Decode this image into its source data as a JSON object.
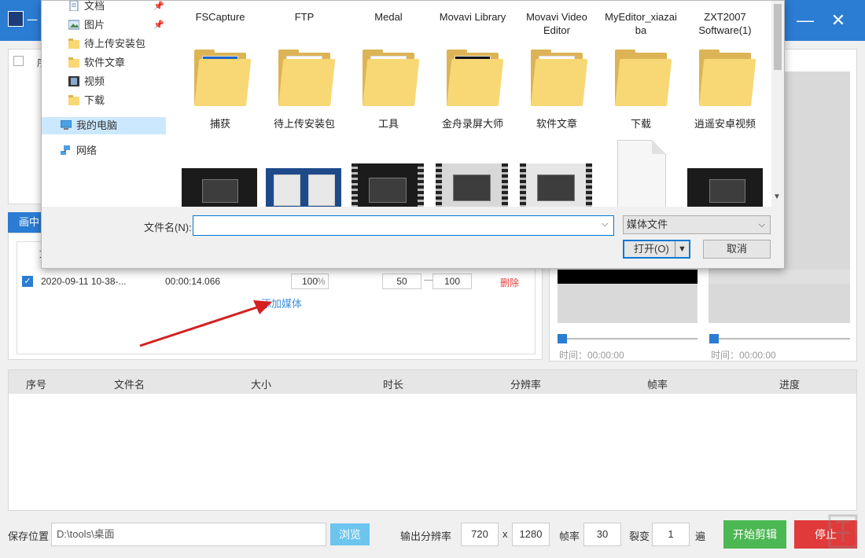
{
  "app": {
    "title": "一",
    "minimize_label": "—",
    "close_label": "✕",
    "top_panel_header_fragment": "序",
    "clip_tab_label": "画中",
    "clip_header_fragment": "文",
    "clip_row": {
      "name": "2020-09-11 10-38-...",
      "duration": "00:00:14.066",
      "percent_value": "100",
      "percent_unit": "%",
      "start_value": "50",
      "separator": "—",
      "end_value": "100",
      "delete_label": "删除"
    },
    "add_media_label": "添加媒体",
    "preview": {
      "time_left": "时间：00:00:00",
      "time_right": "时间：00:00:00"
    },
    "table": {
      "columns": [
        "序号",
        "文件名",
        "大小",
        "时长",
        "分辨率",
        "帧率",
        "进度"
      ]
    },
    "bottom": {
      "save_label": "保存位置",
      "save_path": "D:\\tools\\桌面",
      "browse_label": "浏览",
      "output_res_label": "输出分辨率",
      "res_width": "720",
      "res_x": "x",
      "res_height": "1280",
      "fps_label": "帧率",
      "fps_value": "30",
      "split_label": "裂变",
      "split_value": "1",
      "split_unit": "遍",
      "start_label": "开始剪辑",
      "stop_label": "停止"
    }
  },
  "dialog": {
    "nav_items": [
      {
        "label": "文档",
        "icon": "document-icon",
        "pinned": true
      },
      {
        "label": "图片",
        "icon": "pictures-icon",
        "pinned": true
      },
      {
        "label": "待上传安装包",
        "icon": "folder-icon",
        "pinned": false
      },
      {
        "label": "软件文章",
        "icon": "folder-icon",
        "pinned": false
      },
      {
        "label": "视频",
        "icon": "video-icon",
        "pinned": false
      },
      {
        "label": "下载",
        "icon": "folder-icon",
        "pinned": false
      },
      {
        "label": "我的电脑",
        "icon": "computer-icon",
        "pinned": false
      },
      {
        "label": "网络",
        "icon": "network-icon",
        "pinned": false
      }
    ],
    "row1": [
      "FSCapture",
      "FTP",
      "Medal",
      "Movavi Library",
      "Movavi Video Editor",
      "MyEditor_xiazai ba",
      "ZXT2007 Software(1)"
    ],
    "row2": [
      "捕获",
      "待上传安装包",
      "工具",
      "金舟录屏大师",
      "软件文章",
      "下载",
      "逍遥安卓视频"
    ],
    "filename_label": "文件名(N):",
    "filename_value": "",
    "filetype_label": "媒体文件",
    "open_label": "打开(O)",
    "cancel_label": "取消"
  },
  "colors": {
    "accent": "#2b7cd3",
    "start_button": "#4cb854",
    "stop_button": "#e03a3a",
    "browse_button": "#6cc4ef",
    "delete_link": "#e83d3d",
    "folder": "#f8d775"
  }
}
